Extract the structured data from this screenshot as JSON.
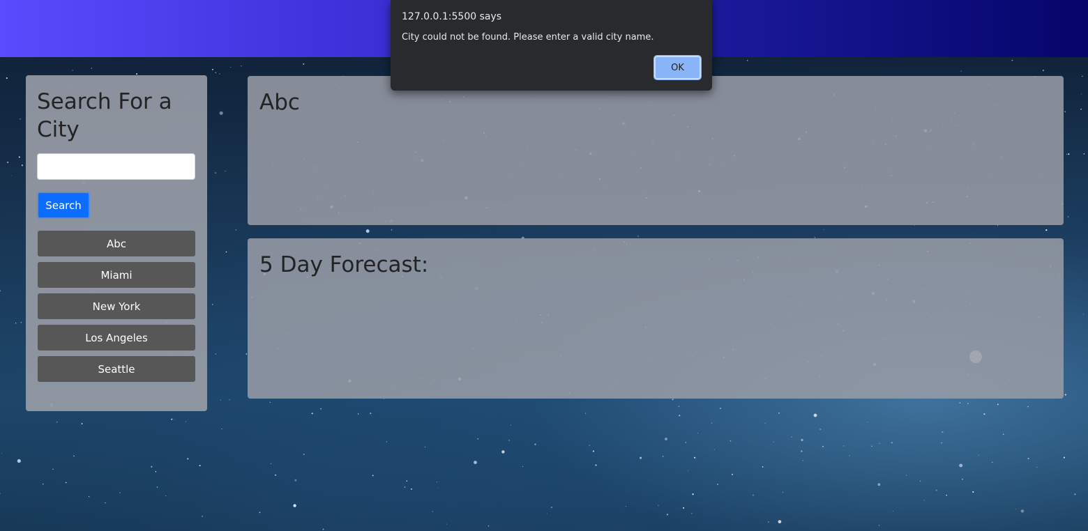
{
  "header": {
    "gradient_start": "#5a4cfe",
    "gradient_end": "#05056a"
  },
  "sidebar": {
    "title": "Search For a City",
    "search_placeholder": "",
    "search_value": "",
    "search_button_label": "Search",
    "history": [
      "Abc",
      "Miami",
      "New York",
      "Los Angeles",
      "Seattle"
    ]
  },
  "current_weather": {
    "city": "Abc"
  },
  "forecast": {
    "title": "5 Day Forecast:"
  },
  "alert_dialog": {
    "title": "127.0.0.1:5500 says",
    "message": "City could not be found. Please enter a valid city name.",
    "ok_label": "OK"
  },
  "colors": {
    "primary_button": "#0d6efd",
    "history_button": "#575757",
    "dialog_background": "#292a2d",
    "dialog_ok": "#8ab4f8"
  }
}
